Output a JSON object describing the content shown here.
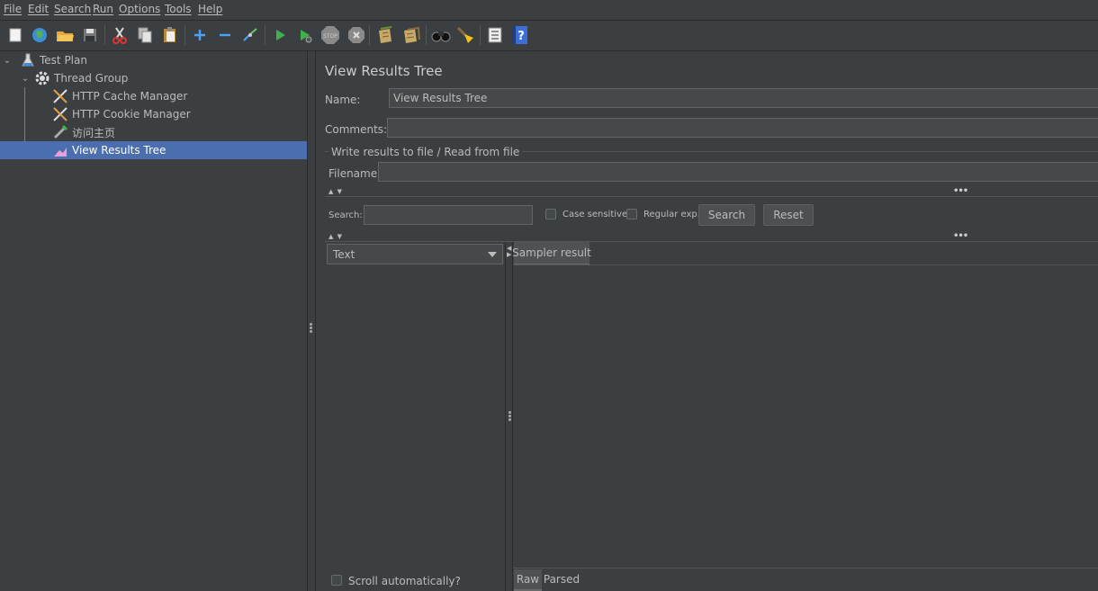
{
  "menu": [
    "File",
    "Edit",
    "Search",
    "Run",
    "Options",
    "Tools",
    "Help"
  ],
  "toolbar": {
    "icons": [
      "new-icon",
      "templates-icon",
      "open-icon",
      "save-icon",
      "cut-icon",
      "copy-icon",
      "paste-icon",
      "expand-icon",
      "collapse-icon",
      "toggle-icon",
      "start-icon",
      "start-no-pause-icon",
      "stop-icon",
      "shutdown-icon",
      "clear-icon",
      "clear-all-icon",
      "search-icon",
      "reset-search-icon",
      "function-helper-icon",
      "help-icon"
    ]
  },
  "tree": {
    "test_plan": "Test Plan",
    "thread_group": "Thread Group",
    "cache_manager": "HTTP Cache Manager",
    "cookie_manager": "HTTP Cookie Manager",
    "sampler": "访问主页",
    "results_tree": "View Results Tree"
  },
  "panel": {
    "title": "View Results Tree",
    "name_label": "Name:",
    "name_value": "View Results Tree",
    "comments_label": "Comments:",
    "comments_value": "",
    "file_section": "Write results to file / Read from file",
    "filename_label": "Filename",
    "filename_value": ""
  },
  "search": {
    "label": "Search:",
    "value": "",
    "case_sensitive": "Case sensitive",
    "regex": "Regular exp.",
    "search_button": "Search",
    "reset_button": "Reset"
  },
  "results": {
    "renderer": "Text",
    "tab_sampler": "Sampler result",
    "scroll_auto": "Scroll automatically?",
    "tab_raw": "Raw",
    "tab_parsed": "Parsed"
  },
  "colors": {
    "background": "#3c3f41",
    "selection": "#4b6eaf",
    "tree_line": "#4a88c7"
  }
}
